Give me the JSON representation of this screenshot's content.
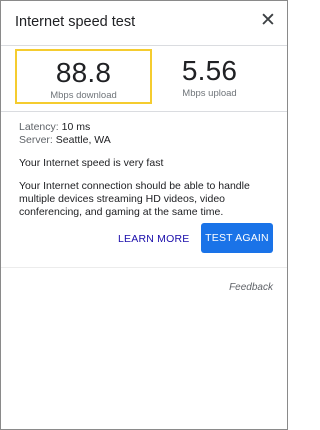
{
  "header": {
    "title": "Internet speed test",
    "close_icon": "close-icon",
    "close_glyph": "✕"
  },
  "download": {
    "value": "88.8",
    "unit": "Mbps download",
    "highlight_color": "#f5cc2f"
  },
  "upload": {
    "value": "5.56",
    "unit": "Mbps upload"
  },
  "details": {
    "latency_label": "Latency:",
    "latency_value": "10 ms",
    "server_label": "Server:",
    "server_value": "Seattle, WA",
    "status": "Your Internet speed is very fast",
    "description": "Your Internet connection should be able to handle multiple devices streaming HD videos, video conferencing, and gaming at the same time."
  },
  "actions": {
    "learn_more": "LEARN MORE",
    "test_again": "TEST AGAIN",
    "primary_color": "#1a73e8"
  },
  "footer": {
    "feedback": "Feedback"
  }
}
